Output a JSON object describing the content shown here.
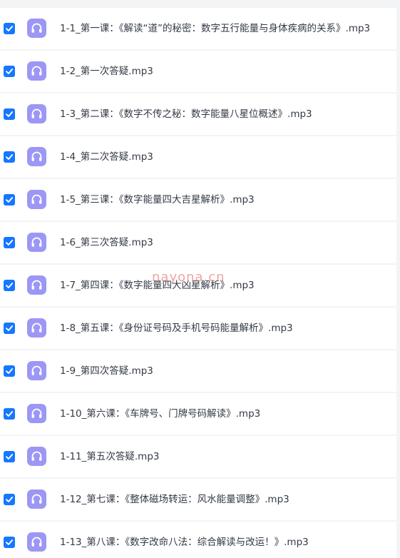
{
  "colors": {
    "checkbox": "#1677ff",
    "audio_icon": "#9c97f5",
    "row_background": "#ffffff",
    "page_background": "#f3f4f6",
    "text": "#333a45",
    "watermark": "#e25858"
  },
  "file_icon": "headphones-icon",
  "files": [
    {
      "name": "1-1_第一课：《解读“道”的秘密：数字五行能量与身体疾病的关系》.mp3",
      "checked": true
    },
    {
      "name": "1-2_第一次答疑.mp3",
      "checked": true
    },
    {
      "name": "1-3_第二课：《数字不传之秘：数字能量八星位概述》.mp3",
      "checked": true
    },
    {
      "name": "1-4_第二次答疑.mp3",
      "checked": true
    },
    {
      "name": "1-5_第三课：《数字能量四大吉星解析》.mp3",
      "checked": true
    },
    {
      "name": "1-6_第三次答疑.mp3",
      "checked": true
    },
    {
      "name": "1-7_第四课：《数字能量四大凶星解析》.mp3",
      "checked": true
    },
    {
      "name": "1-8_第五课：《身份证号码及手机号码能量解析》.mp3",
      "checked": true
    },
    {
      "name": "1-9_第四次答疑.mp3",
      "checked": true
    },
    {
      "name": "1-10_第六课：《车牌号、门牌号码解读》.mp3",
      "checked": true
    },
    {
      "name": "1-11_第五次答疑.mp3",
      "checked": true
    },
    {
      "name": "1-12_第七课：《整体磁场转运：风水能量调整》.mp3",
      "checked": true
    },
    {
      "name": "1-13_第八课：《数字改命八法：综合解读与改运！》.mp3",
      "checked": true
    }
  ],
  "watermark": "nayona.cn"
}
